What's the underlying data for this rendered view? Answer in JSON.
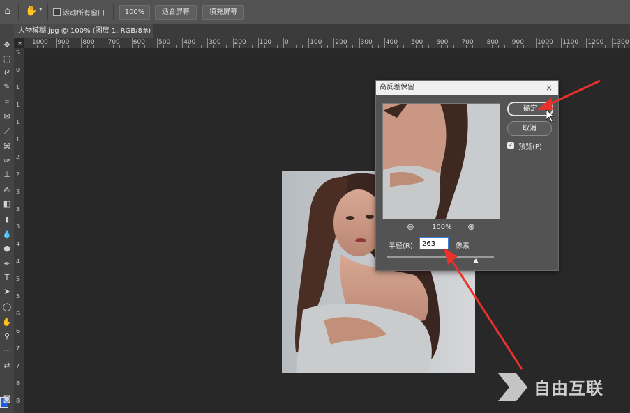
{
  "options_bar": {
    "scroll_all_windows_label": "滚动所有窗口",
    "zoom_button": "100%",
    "fit_screen_button": "适合屏幕",
    "fill_screen_button": "填充屏幕"
  },
  "document_tab": {
    "title": "人物模糊.jpg @ 100% (图层 1, RGB/8#) *",
    "close": "×"
  },
  "ruler_h_labels": [
    "1000",
    "900",
    "800",
    "700",
    "600",
    "500",
    "400",
    "300",
    "200",
    "100",
    "0",
    "100",
    "200",
    "300",
    "400",
    "500",
    "600",
    "700",
    "800",
    "900",
    "1000",
    "1100",
    "1200",
    "1300"
  ],
  "ruler_v_labels": [
    "5",
    "0",
    "1",
    "1",
    "1",
    "1",
    "2",
    "2",
    "3",
    "3",
    "3",
    "4",
    "4",
    "5",
    "5",
    "6",
    "6",
    "7",
    "7",
    "8",
    "8"
  ],
  "dialog": {
    "title": "高反差保留",
    "close": "×",
    "ok_button": "确定",
    "cancel_button": "取消",
    "preview_label": "预览(P)",
    "preview_checked": true,
    "zoom_value": "100%",
    "radius_label": "半径(R):",
    "radius_value": "263",
    "radius_unit": "像素",
    "slider_position": 0.84
  },
  "watermark": {
    "text": "自由互联"
  },
  "colors": {
    "foreground": "#1b5de0",
    "annotation_arrow": "#e8322b",
    "input_focus": "#3a7fd4"
  }
}
